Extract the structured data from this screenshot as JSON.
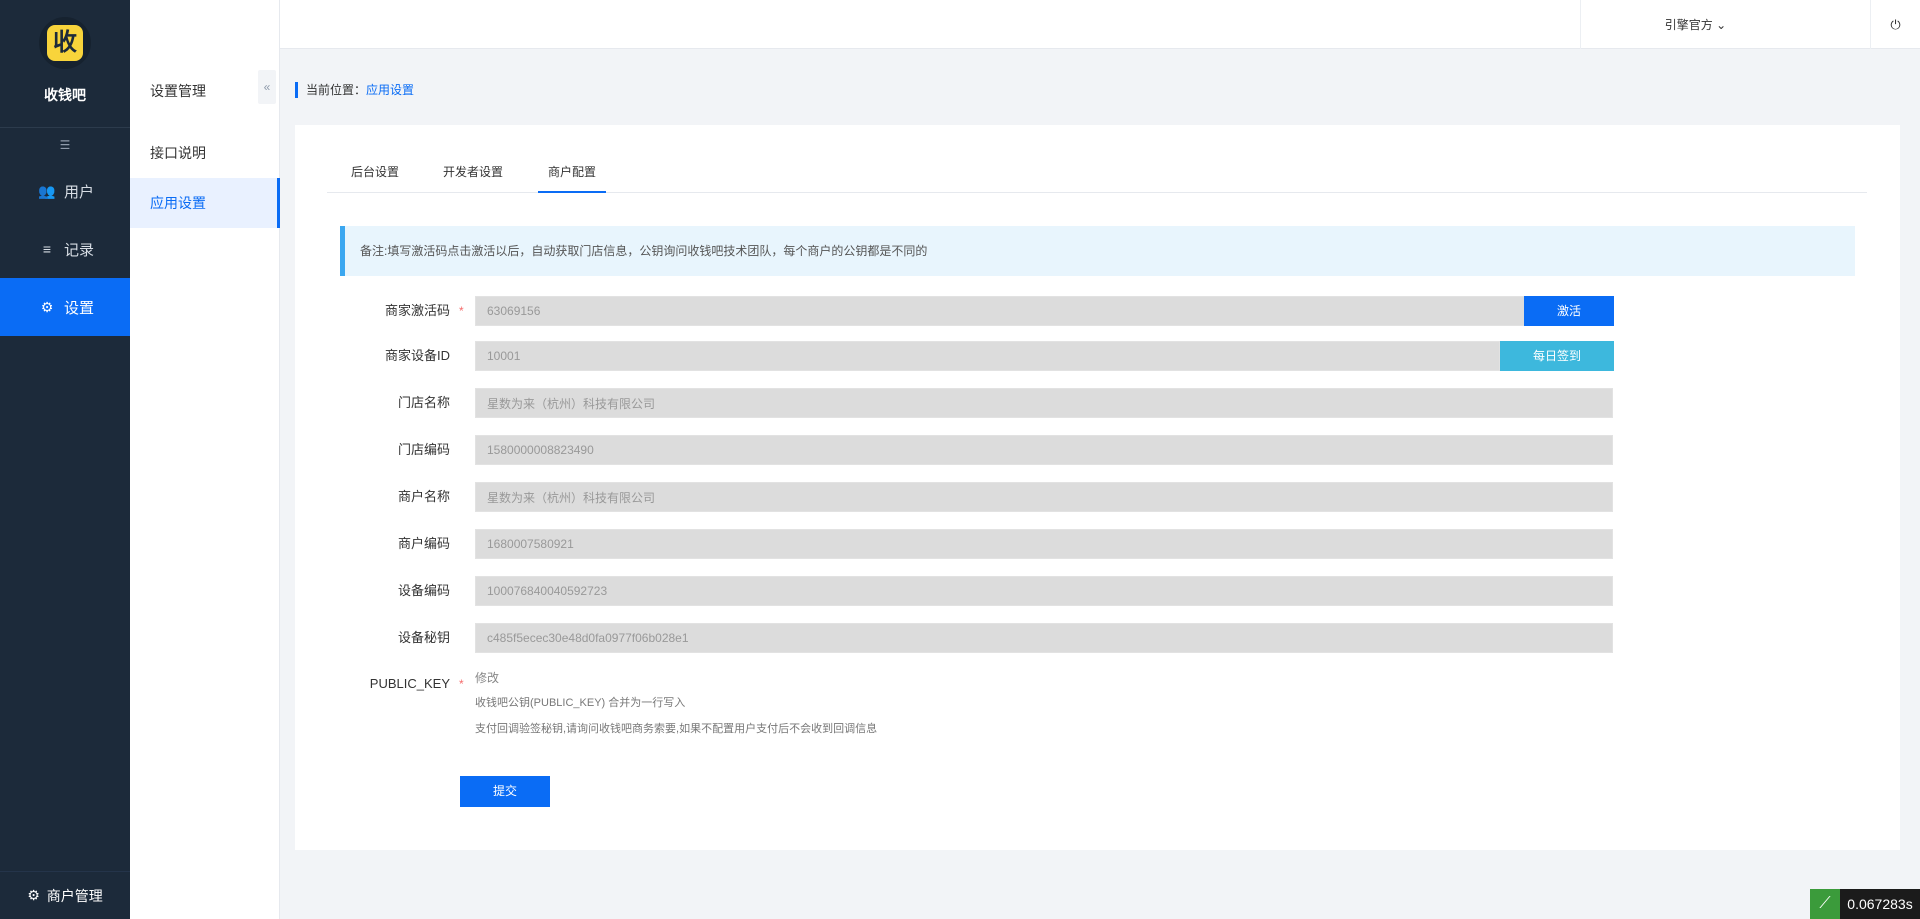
{
  "brand": {
    "logo_char": "收",
    "name": "收钱吧"
  },
  "sidebar": {
    "collapse_glyph": "☰",
    "items": [
      {
        "label": "用户",
        "icon": "users-icon",
        "glyph": "👥"
      },
      {
        "label": "记录",
        "icon": "list-icon",
        "glyph": "≡"
      },
      {
        "label": "设置",
        "icon": "gear-icon",
        "glyph": "⚙"
      }
    ],
    "bottom": {
      "label": "商户管理",
      "icon": "gear-icon",
      "glyph": "⚙"
    }
  },
  "sub_sidebar": {
    "title": "设置管理",
    "collapse_glyph": "«",
    "items": [
      {
        "label": "接口说明"
      },
      {
        "label": "应用设置"
      }
    ]
  },
  "topbar": {
    "user": "引擎官方 ⌄",
    "power_glyph": "⏻"
  },
  "breadcrumb": {
    "prefix": "当前位置：",
    "current": "应用设置"
  },
  "tabs": [
    {
      "label": "后台设置"
    },
    {
      "label": "开发者设置"
    },
    {
      "label": "商户配置"
    }
  ],
  "notice": "备注:填写激活码点击激活以后，自动获取门店信息，公钥询问收钱吧技术团队，每个商户的公钥都是不同的",
  "form": {
    "required_mark": "*",
    "fields": [
      {
        "label": "商家激活码",
        "value": "63069156",
        "required": true
      },
      {
        "label": "商家设备ID",
        "value": "10001"
      },
      {
        "label": "门店名称",
        "value": "星数为来（杭州）科技有限公司"
      },
      {
        "label": "门店编码",
        "value": "1580000008823490"
      },
      {
        "label": "商户名称",
        "value": "星数为来（杭州）科技有限公司"
      },
      {
        "label": "商户编码",
        "value": "1680007580921"
      },
      {
        "label": "设备编码",
        "value": "100076840040592723"
      },
      {
        "label": "设备秘钥",
        "value": "c485f5ecec30e48d0fa0977f06b028e1"
      }
    ],
    "activate_label": "激活",
    "checkin_label": "每日签到",
    "public_key": {
      "label": "PUBLIC_KEY",
      "edit": "修改",
      "hint1": "收钱吧公钥(PUBLIC_KEY) 合并为一行写入",
      "hint2": "支付回调验签秘钥,请询问收钱吧商务索要,如果不配置用户支付后不会收到回调信息"
    },
    "submit_label": "提交"
  },
  "timer": {
    "glyph": "⟋",
    "value": "0.067283s"
  },
  "colors": {
    "sidebar": "#1c2a3a",
    "accent": "#0a6cf5",
    "cyan": "#3db8dd",
    "notice_bg": "#e8f5fd"
  }
}
